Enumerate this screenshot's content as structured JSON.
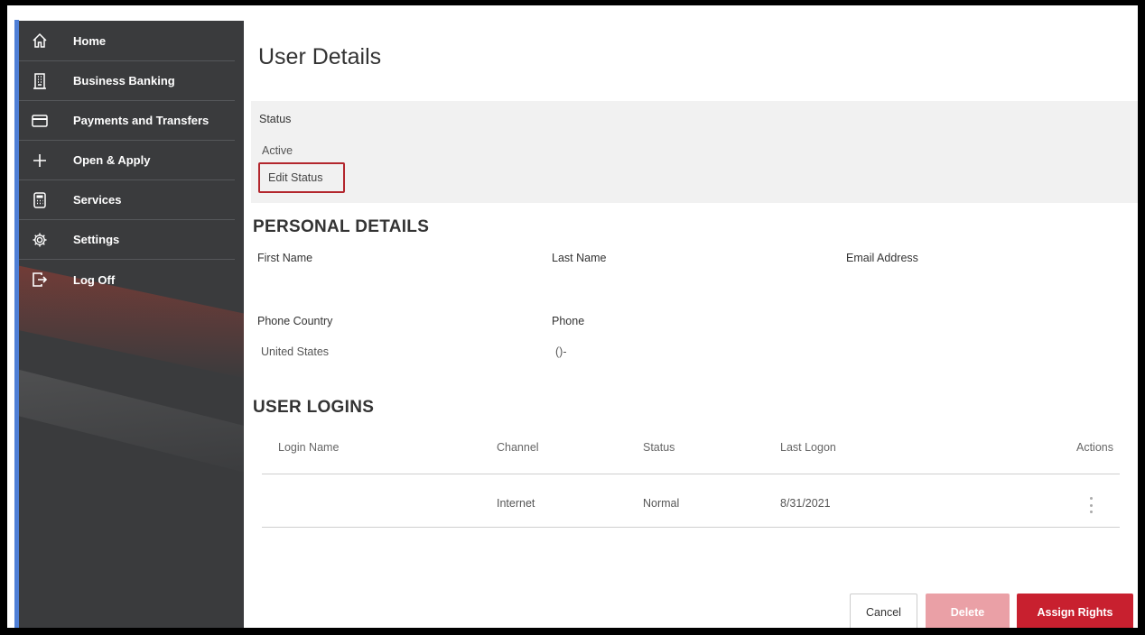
{
  "sidebar": {
    "items": [
      {
        "label": "Home",
        "icon": "home-icon"
      },
      {
        "label": "Business Banking",
        "icon": "building-icon"
      },
      {
        "label": "Payments and Transfers",
        "icon": "card-icon"
      },
      {
        "label": "Open & Apply",
        "icon": "plus-icon"
      },
      {
        "label": "Services",
        "icon": "calculator-icon"
      },
      {
        "label": "Settings",
        "icon": "gear-icon"
      },
      {
        "label": "Log Off",
        "icon": "logout-icon"
      }
    ]
  },
  "page": {
    "title": "User Details"
  },
  "status": {
    "label": "Status",
    "value": "Active",
    "edit_label": "Edit Status"
  },
  "personal_details": {
    "heading": "PERSONAL DETAILS",
    "first_name_label": "First Name",
    "last_name_label": "Last Name",
    "email_label": "Email Address",
    "phone_country_label": "Phone Country",
    "phone_country_value": "United States",
    "phone_label": "Phone",
    "phone_value": "()-"
  },
  "user_logins": {
    "heading": "USER LOGINS",
    "columns": [
      "Login Name",
      "Channel",
      "Status",
      "Last Logon",
      "Actions"
    ],
    "rows": [
      {
        "login_name": "",
        "channel": "Internet",
        "status": "Normal",
        "last_logon": "8/31/2021"
      }
    ]
  },
  "buttons": {
    "cancel": "Cancel",
    "delete": "Delete",
    "assign_rights": "Assign Rights"
  },
  "colors": {
    "sidebar_bg": "#3a3b3d",
    "accent_red": "#c8202f",
    "highlight_border": "#b3262d",
    "accent_blue": "#4f7fd6"
  }
}
